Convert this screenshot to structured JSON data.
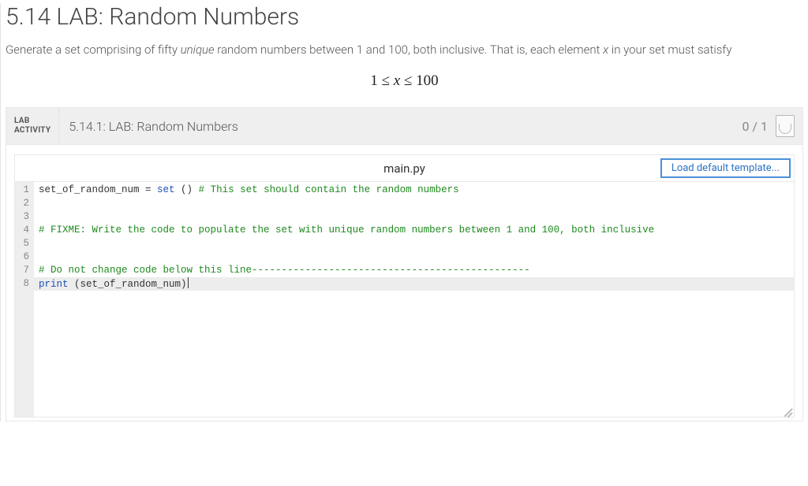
{
  "page": {
    "title": "5.14 LAB: Random Numbers",
    "instructions_a": "Generate a set comprising of fifty ",
    "instructions_em": "unique",
    "instructions_b": " random numbers between 1 and 100, both inclusive. That is, each element ",
    "instructions_var": "x",
    "instructions_c": " in your set must satisfy",
    "math": "1 ≤ x ≤ 100"
  },
  "activity": {
    "tag_line1": "LAB",
    "tag_line2": "ACTIVITY",
    "title": "5.14.1: LAB: Random Numbers",
    "score": "0 / 1"
  },
  "editor": {
    "filename": "main.py",
    "load_default_label": "Load default template...",
    "lines": [
      {
        "tokens": [
          {
            "t": "set_of_random_num = "
          },
          {
            "t": "set",
            "cls": "token-builtin"
          },
          {
            "t": " () "
          },
          {
            "t": "# This set should contain the random numbers",
            "cls": "token-comment"
          }
        ]
      },
      {
        "tokens": []
      },
      {
        "tokens": []
      },
      {
        "tokens": [
          {
            "t": "# FIXME: Write the code to populate the set with unique random numbers between 1 and 100, both inclusive",
            "cls": "token-comment"
          }
        ]
      },
      {
        "tokens": []
      },
      {
        "tokens": []
      },
      {
        "tokens": [
          {
            "t": "# Do not change code below this line-----------------------------------------------",
            "cls": "token-comment"
          }
        ]
      },
      {
        "cursor": true,
        "tokens": [
          {
            "t": "print",
            "cls": "token-keyword"
          },
          {
            "t": " (set_of_random_num)"
          }
        ]
      }
    ]
  }
}
